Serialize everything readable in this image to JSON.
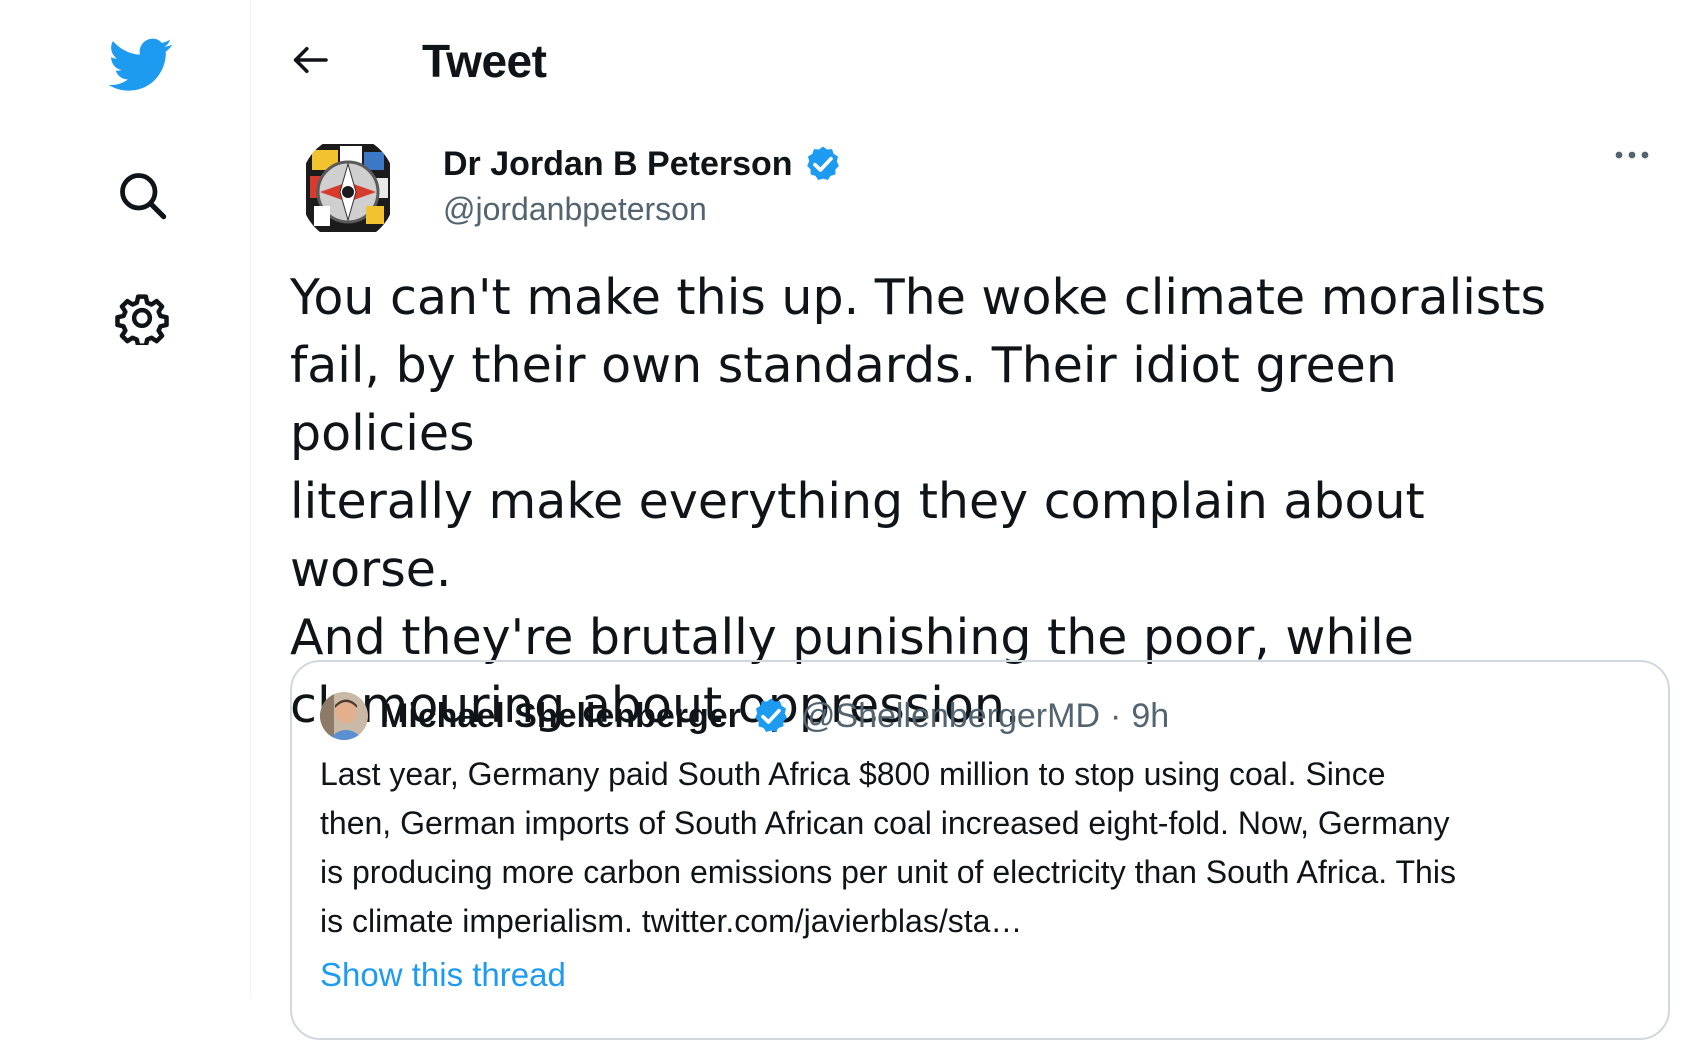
{
  "header": {
    "title": "Tweet"
  },
  "tweet": {
    "author_name": "Dr Jordan B Peterson",
    "author_handle": "@jordanbpeterson",
    "text_lines": [
      "You can't make this up. The woke climate moralists",
      "fail, by their own standards. Their idiot green policies",
      "literally make everything they complain about worse.",
      "And they're brutally punishing the poor, while",
      "clamouring about oppression."
    ]
  },
  "quote": {
    "author_name": "Michael Shellenberger",
    "author_handle": "@ShellenbergerMD",
    "separator": "·",
    "time": "9h",
    "text_lines": [
      "Last year, Germany paid South Africa $800 million to stop using coal. Since",
      "then, German imports of South African coal increased eight-fold. Now, Germany",
      "is producing more carbon emissions per unit of electricity than South Africa. This",
      "is climate imperialism. twitter.com/javierblas/sta…"
    ],
    "show_thread": "Show this thread"
  },
  "colors": {
    "brand_blue": "#1d9bf0",
    "text_primary": "#0f1419",
    "text_secondary": "#536471",
    "border": "#cfd9de"
  },
  "icons": {
    "logo": "twitter-bird-icon",
    "search": "search-icon",
    "settings": "gear-icon",
    "back": "back-arrow-icon",
    "more": "more-dots-icon",
    "verified": "verified-badge-icon"
  }
}
